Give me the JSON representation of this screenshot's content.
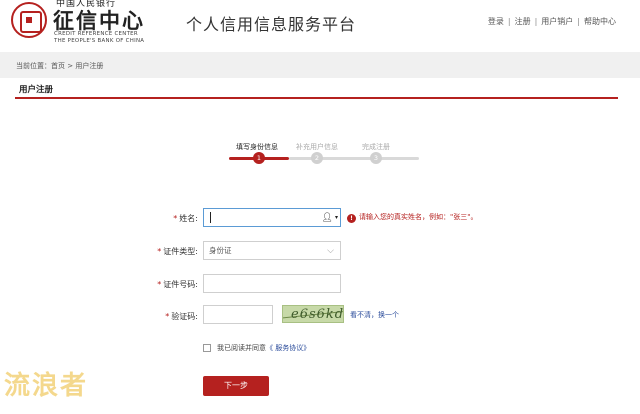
{
  "header": {
    "logo_top": "中国人民银行",
    "logo_title": "征信中心",
    "logo_en_line1": "CREDIT REFERENCE CENTER",
    "logo_en_line2": "THE PEOPLE'S BANK OF CHINA",
    "platform_title": "个人信用信息服务平台",
    "nav": [
      "登录",
      "注册",
      "用户销户",
      "帮助中心"
    ],
    "nav_separator": "|"
  },
  "breadcrumb": "当前位置：首页 > 用户注册",
  "panel": {
    "title": "用户注册"
  },
  "steps": [
    {
      "number": "1",
      "label": "填写身份信息",
      "active": true
    },
    {
      "number": "2",
      "label": "补充用户信息",
      "active": false
    },
    {
      "number": "3",
      "label": "完成注册",
      "active": false
    }
  ],
  "form": {
    "required_mark": "*",
    "name_label": "姓名:",
    "name_value": "",
    "name_hint_icon": "!",
    "name_hint": "请输入您的真实姓名，例如：\"张三\"。",
    "id_type_label": "证件类型:",
    "id_type_value": "身份证",
    "id_number_label": "证件号码:",
    "id_number_value": "",
    "captcha_label": "验证码:",
    "captcha_value": "",
    "captcha_text": "e6s6kd",
    "captcha_refresh": "看不清，换一个",
    "agree_prefix": "我已阅读并同意",
    "agree_link": "《 服务协议》",
    "next_button": "下一步"
  },
  "watermark": "流浪者",
  "colors": {
    "accent": "#b5211f",
    "link": "#2b4c9b",
    "inactive_step": "#d9d9d9"
  }
}
